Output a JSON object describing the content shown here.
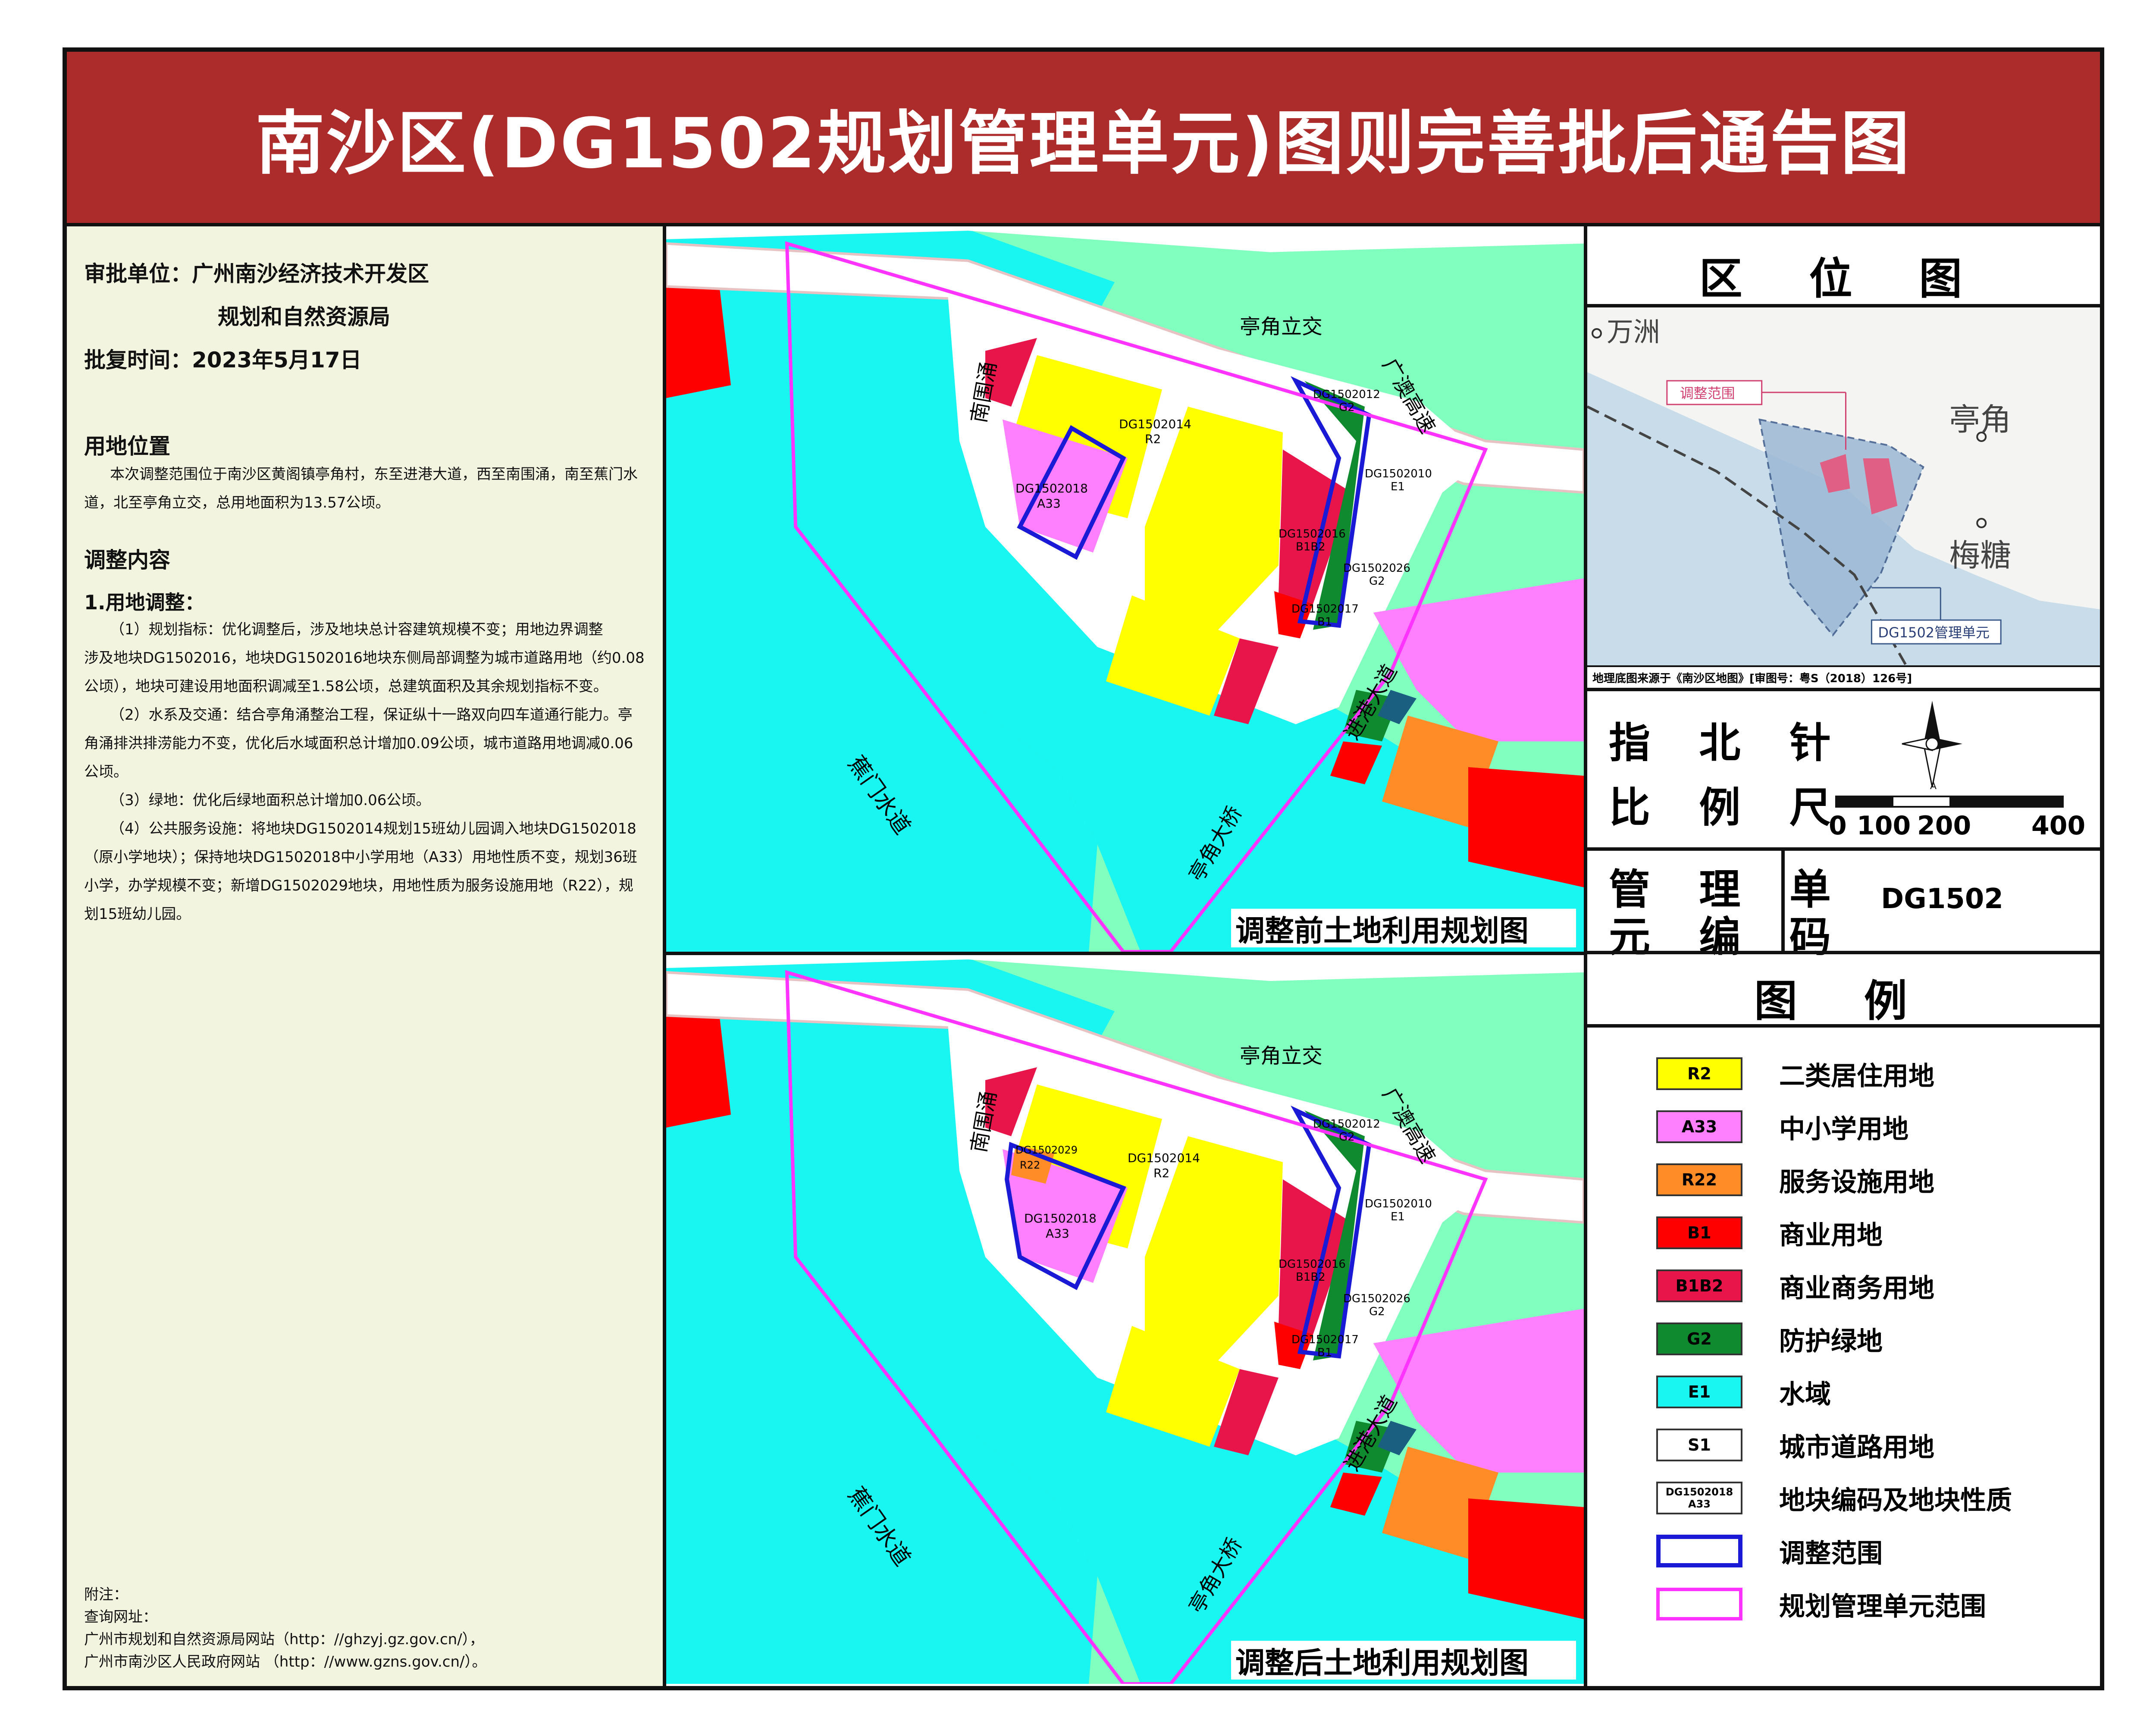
{
  "title": "南沙区(DG1502规划管理单元)图则完善批后通告图",
  "approval": {
    "unit_label": "审批单位：广州南沙经济技术开发区",
    "unit_line2": "规划和自然资源局",
    "date_label": "批复时间：2023年5月17日"
  },
  "location": {
    "heading": "用地位置",
    "text": "本次调整范围位于南沙区黄阁镇亭角村，东至进港大道，西至南围涌，南至蕉门水道，北至亭角立交，总用地面积为13.57公顷。"
  },
  "adjustment": {
    "heading": "调整内容",
    "sub": "1.用地调整：",
    "p1": "（1）规划指标：优化调整后，涉及地块总计容建筑规模不变；用地边界调整",
    "p1b": "涉及地块DG1502016，地块DG1502016地块东侧局部调整为城市道路用地（约0.08公顷），地块可建设用地面积调减至1.58公顷，总建筑面积及其余规划指标不变。",
    "p2": "（2）水系及交通：结合亭角涌整治工程，保证纵十一路双向四车道通行能力。亭角涌排洪排涝能力不变，优化后水域面积总计增加0.09公顷，城市道路用地调减0.06公顷。",
    "p3": "（3）绿地：优化后绿地面积总计增加0.06公顷。",
    "p4": "（4）公共服务设施：将地块DG1502014规划15班幼儿园调入地块DG1502018",
    "p4b": "（原小学地块）；保持地块DG1502018中小学用地（A33）用地性质不变，规划36班小学，办学规模不变；新增DG1502029地块，用地性质为服务设施用地（R22），规划15班幼儿园。"
  },
  "notes": {
    "line1": "附注：",
    "line2": "查询网址：",
    "line3": "广州市规划和自然资源局网站（http：//ghzyj.gz.gov.cn/），",
    "line4": "广州市南沙区人民政府网站  （http：//www.gzns.gov.cn/）。"
  },
  "map_before": {
    "caption": "调整前土地利用规划图",
    "labels": {
      "interchange": "亭角立交",
      "expressway": "广澳高速",
      "creek": "南围涌",
      "waterway": "蕉门水道",
      "bridge": "亭角大桥",
      "avenue": "进港大道"
    },
    "parcels": {
      "p2014": [
        "DG1502014",
        "R2"
      ],
      "p2018": [
        "DG1502018",
        "A33"
      ],
      "p2012": [
        "DG1502012",
        "G2"
      ],
      "p2010": [
        "DG1502010",
        "E1"
      ],
      "p2016": [
        "DG1502016",
        "B1B2"
      ],
      "p2026": [
        "DG1502026",
        "G2"
      ],
      "p2017": [
        "DG1502017",
        "B1"
      ]
    }
  },
  "map_after": {
    "caption": "调整后土地利用规划图",
    "labels": {
      "interchange": "亭角立交",
      "expressway": "广澳高速",
      "creek": "南围涌",
      "waterway": "蕉门水道",
      "bridge": "亭角大桥",
      "avenue": "进港大道"
    },
    "parcels": {
      "p2014": [
        "DG1502014",
        "R2"
      ],
      "p2018": [
        "DG1502018",
        "A33"
      ],
      "p2029": [
        "DG1502029",
        "R22"
      ],
      "p2012": [
        "DG1502012",
        "G2"
      ],
      "p2010": [
        "DG1502010",
        "E1"
      ],
      "p2016": [
        "DG1502016",
        "B1B2"
      ],
      "p2026": [
        "DG1502026",
        "G2"
      ],
      "p2017": [
        "DG1502017",
        "B1"
      ]
    }
  },
  "location_map": {
    "title": "区 位 图",
    "wanzhou": "万洲",
    "tingjiao": "亭角",
    "meitang": "梅糖",
    "adjust_range": "调整范围",
    "unit": "DG1502管理单元",
    "source": "地理底图来源于《南沙区地图》[审图号：粤S（2018）126号]"
  },
  "compass_label": "指 北 针",
  "scale_label": "比 例 尺",
  "scale_ticks": [
    "0",
    "100",
    "200",
    "400"
  ],
  "unit_code_label_1": "管 理 单",
  "unit_code_label_2": "元 编 码",
  "unit_code": "DG1502",
  "legend": {
    "title": "图  例",
    "items": [
      {
        "code": "R2",
        "label": "二类居住用地",
        "color": "#ffff00"
      },
      {
        "code": "A33",
        "label": "中小学用地",
        "color": "#ff80ff"
      },
      {
        "code": "R22",
        "label": "服务设施用地",
        "color": "#ff8c26"
      },
      {
        "code": "B1",
        "label": "商业用地",
        "color": "#ff0000"
      },
      {
        "code": "B1B2",
        "label": "商业商务用地",
        "color": "#e8154b"
      },
      {
        "code": "G2",
        "label": "防护绿地",
        "color": "#0f8a2e"
      },
      {
        "code": "E1",
        "label": "水域",
        "color": "#19f5f0"
      },
      {
        "code": "S1",
        "label": "城市道路用地",
        "color": "#ffffff"
      },
      {
        "code": "DG1502018",
        "code2": "A33",
        "label": "地块编码及地块性质",
        "color": "#ffffff"
      },
      {
        "code": "",
        "label": "调整范围",
        "color": "#ffffff"
      },
      {
        "code": "",
        "label": "规划管理单元范围",
        "color": "#ffffff"
      }
    ]
  },
  "colors": {
    "title_bg": "#ac2b2b",
    "residential": "#ffff00",
    "school": "#ff80ff",
    "service": "#ff8c26",
    "commercial": "#ff0000",
    "business": "#e8154b",
    "green": "#0f8a2e",
    "green_light": "#33e833",
    "green_pale": "#80ffbf",
    "water": "#19f5f0",
    "adjust_border": "#1a1ad6",
    "unit_border": "#ff33ff"
  }
}
